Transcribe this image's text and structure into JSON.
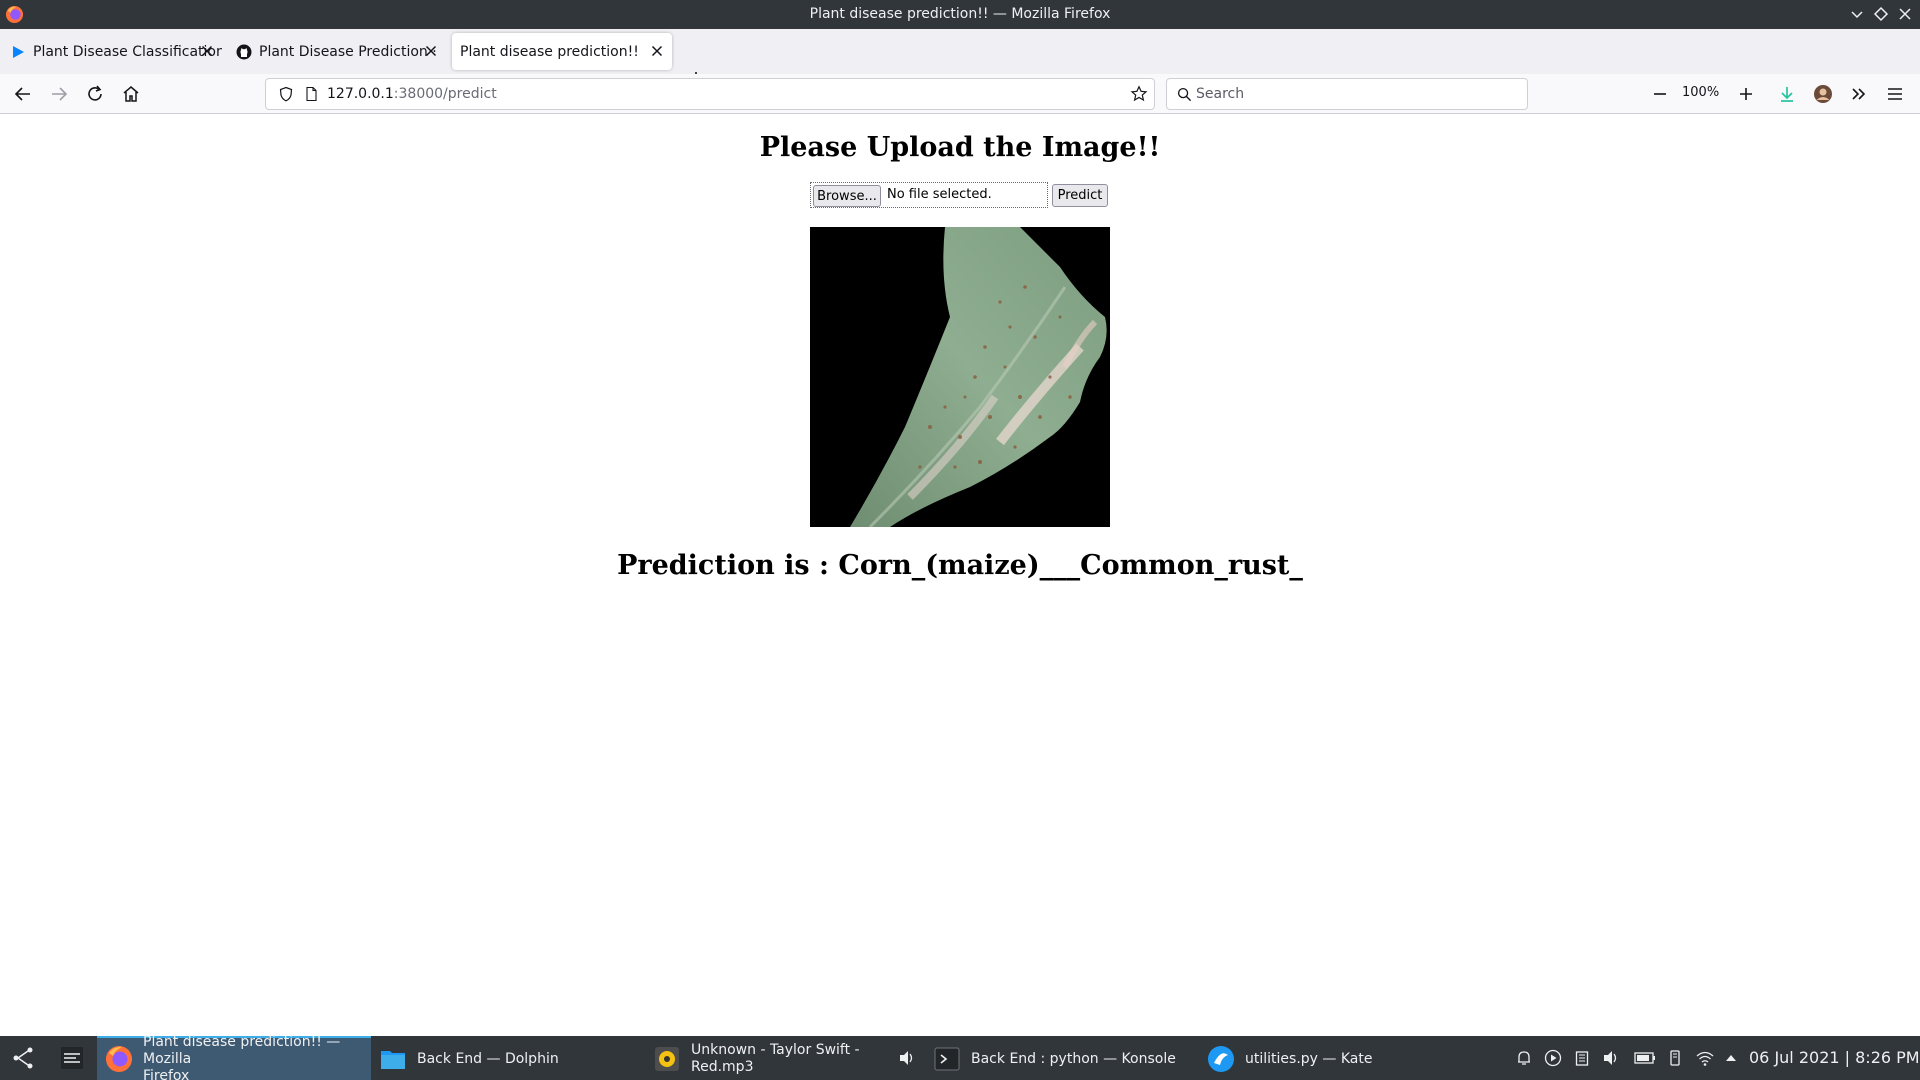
{
  "window": {
    "title": "Plant disease prediction!! — Mozilla Firefox"
  },
  "tabs": [
    {
      "label": "Plant Disease Classification",
      "icon": "play-icon",
      "active": false
    },
    {
      "label": "Plant Disease Prediction · ",
      "icon": "github-icon",
      "active": false
    },
    {
      "label": "Plant disease prediction!!",
      "icon": "none",
      "active": true
    }
  ],
  "navbar": {
    "url_host": "127.0.0.1",
    "url_path": ":38000/predict",
    "search_placeholder": "Search",
    "zoom": "100%"
  },
  "page": {
    "heading": "Please Upload the Image!!",
    "browse_label": "Browse...",
    "file_status": "No file selected.",
    "predict_label": "Predict",
    "prediction_text": "Prediction is : Corn_(maize)___Common_rust_",
    "image_subject": "corn leaf with common rust spots"
  },
  "taskbar": {
    "tasks": [
      {
        "line1": "Plant disease prediction!! — Mozilla",
        "line2": "Firefox",
        "icon": "firefox-icon",
        "active": true
      },
      {
        "line1": "Back End — Dolphin",
        "line2": "",
        "icon": "folder-icon",
        "active": false
      },
      {
        "line1": "Unknown - Taylor Swift -",
        "line2": "Red.mp3",
        "icon": "music-player-icon",
        "active": false
      },
      {
        "line1": "Back End : python — Konsole",
        "line2": "",
        "icon": "terminal-icon",
        "active": false
      },
      {
        "line1": "utilities.py — Kate",
        "line2": "",
        "icon": "kate-icon",
        "active": false
      }
    ],
    "clock": "06 Jul 2021 | 8:26 PM"
  },
  "colors": {
    "titlebar": "#31363b",
    "tabstrip": "#f0f0f4",
    "taskbar": "#31363b",
    "taskbar_active": "#3e5a72",
    "accent": "#3daee9",
    "download_accent": "#2ac3a2"
  }
}
